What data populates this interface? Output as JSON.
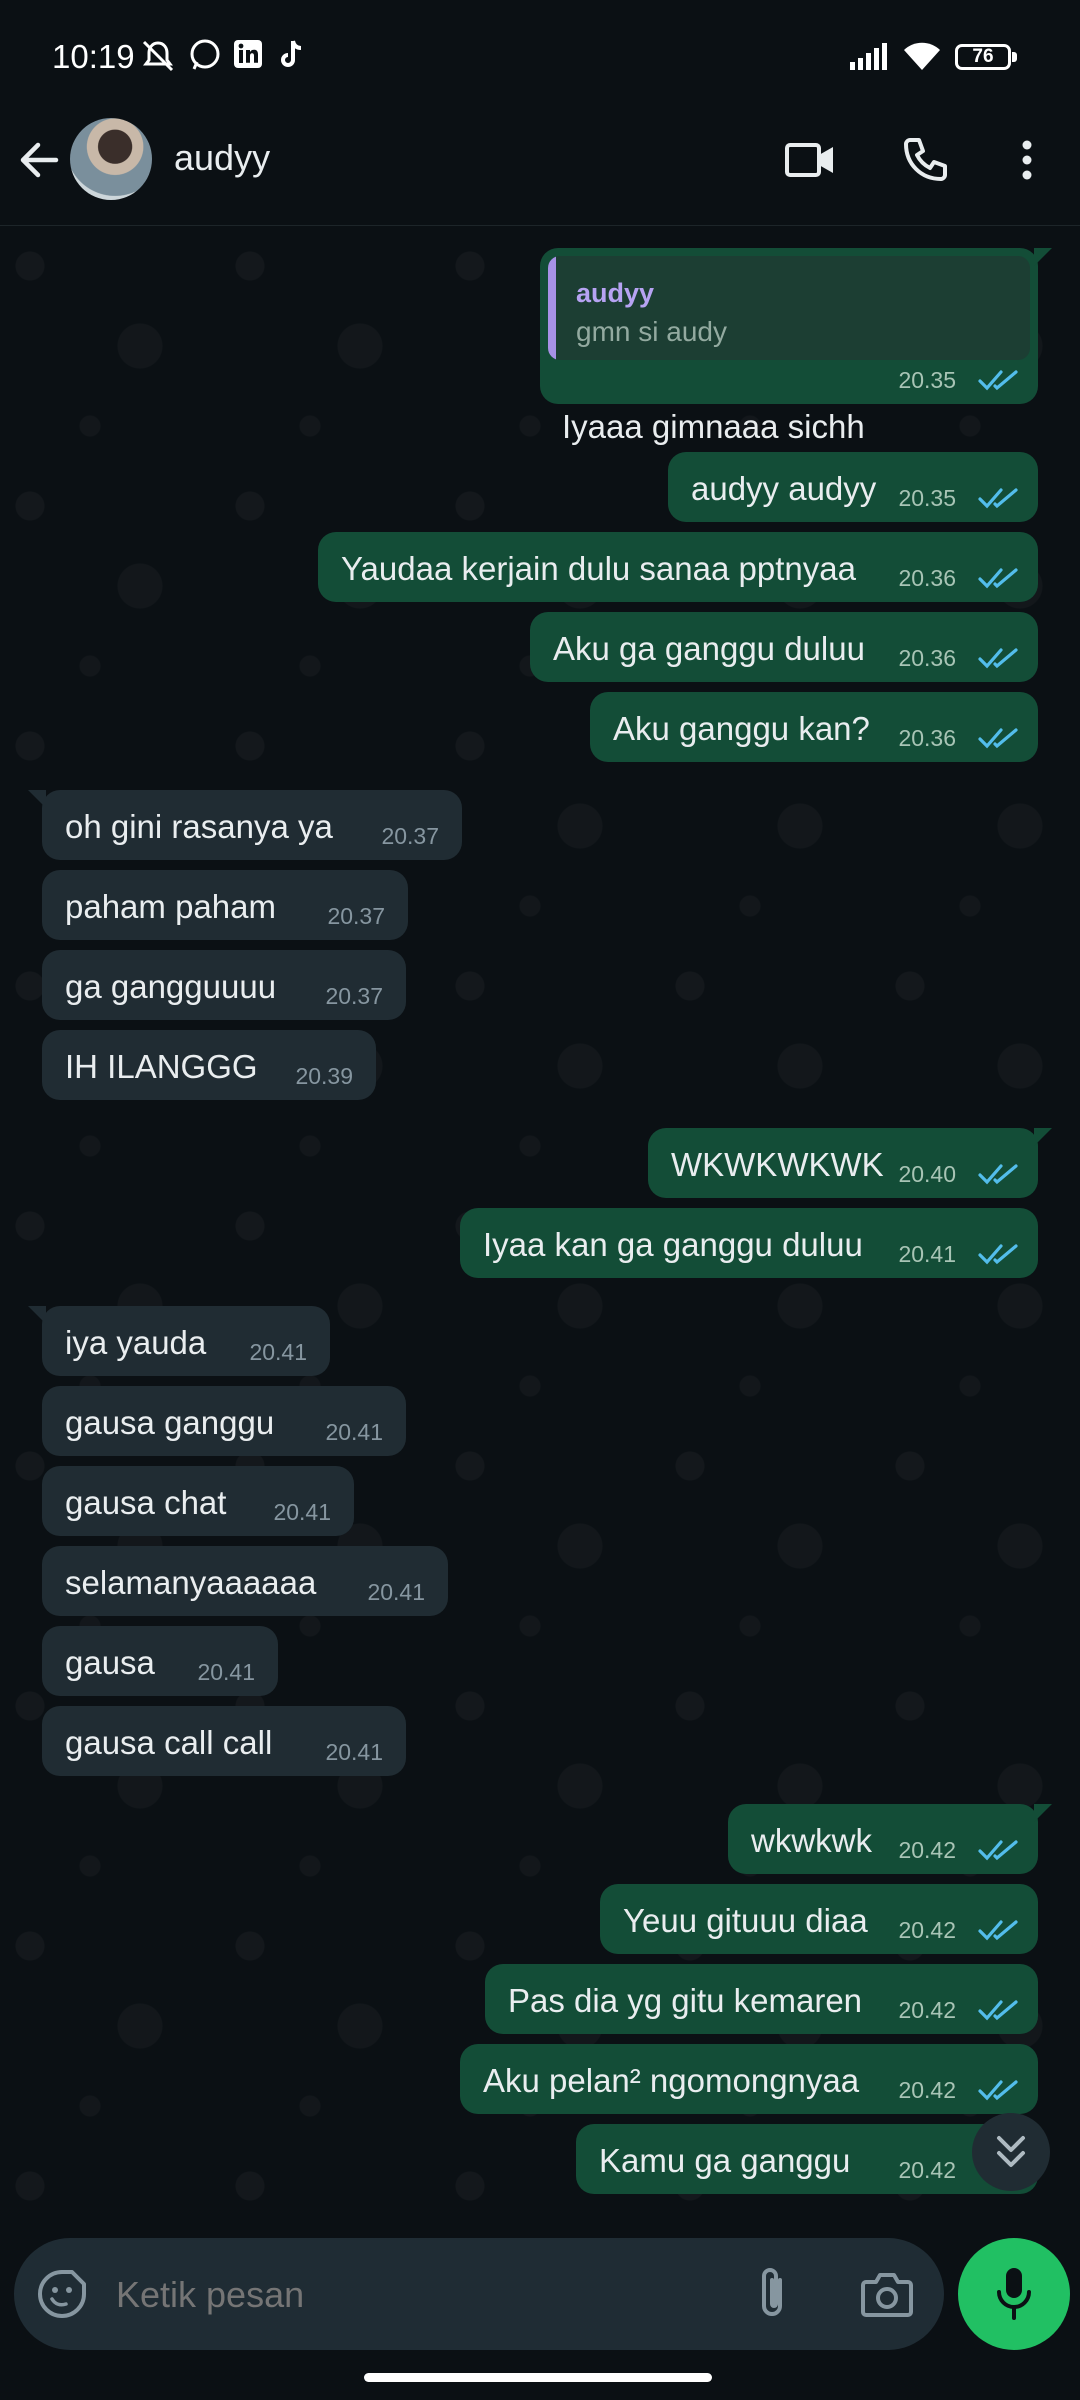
{
  "status_bar": {
    "time": "10:19",
    "battery": "76"
  },
  "header": {
    "contact_name": "audyy"
  },
  "quoted": {
    "name": "audyy",
    "text": "gmn si audy"
  },
  "messages": [
    {
      "text": "Iyaaa gimnaaa sichh",
      "time": "20.35"
    },
    {
      "text": "audyy audyy",
      "time": "20.35"
    },
    {
      "text": "Yaudaa kerjain dulu sanaa pptnyaa",
      "time": "20.36"
    },
    {
      "text": "Aku ga ganggu duluu",
      "time": "20.36"
    },
    {
      "text": "Aku ganggu kan?",
      "time": "20.36"
    },
    {
      "text": "oh gini rasanya ya",
      "time": "20.37"
    },
    {
      "text": "paham paham",
      "time": "20.37"
    },
    {
      "text": "ga gangguuuu",
      "time": "20.37"
    },
    {
      "text": "IH ILANGGG",
      "time": "20.39"
    },
    {
      "text": "WKWKWKWK",
      "time": "20.40"
    },
    {
      "text": "Iyaa kan ga ganggu duluu",
      "time": "20.41"
    },
    {
      "text": "iya yauda",
      "time": "20.41"
    },
    {
      "text": "gausa ganggu",
      "time": "20.41"
    },
    {
      "text": "gausa chat",
      "time": "20.41"
    },
    {
      "text": "selamanyaaaaaa",
      "time": "20.41"
    },
    {
      "text": "gausa",
      "time": "20.41"
    },
    {
      "text": "gausa call call",
      "time": "20.41"
    },
    {
      "text": "wkwkwk",
      "time": "20.42"
    },
    {
      "text": "Yeuu gituuu diaa",
      "time": "20.42"
    },
    {
      "text": "Pas dia yg gitu kemaren",
      "time": "20.42"
    },
    {
      "text": "Aku pelan² ngomongnyaa",
      "time": "20.42"
    },
    {
      "text": "Kamu ga ganggu",
      "time": "20.42"
    }
  ],
  "input": {
    "placeholder": "Ketik pesan"
  },
  "colors": {
    "outgoing": "#134d37",
    "incoming": "#202c33",
    "read_ticks": "#53bdeb",
    "mic": "#21c063"
  }
}
